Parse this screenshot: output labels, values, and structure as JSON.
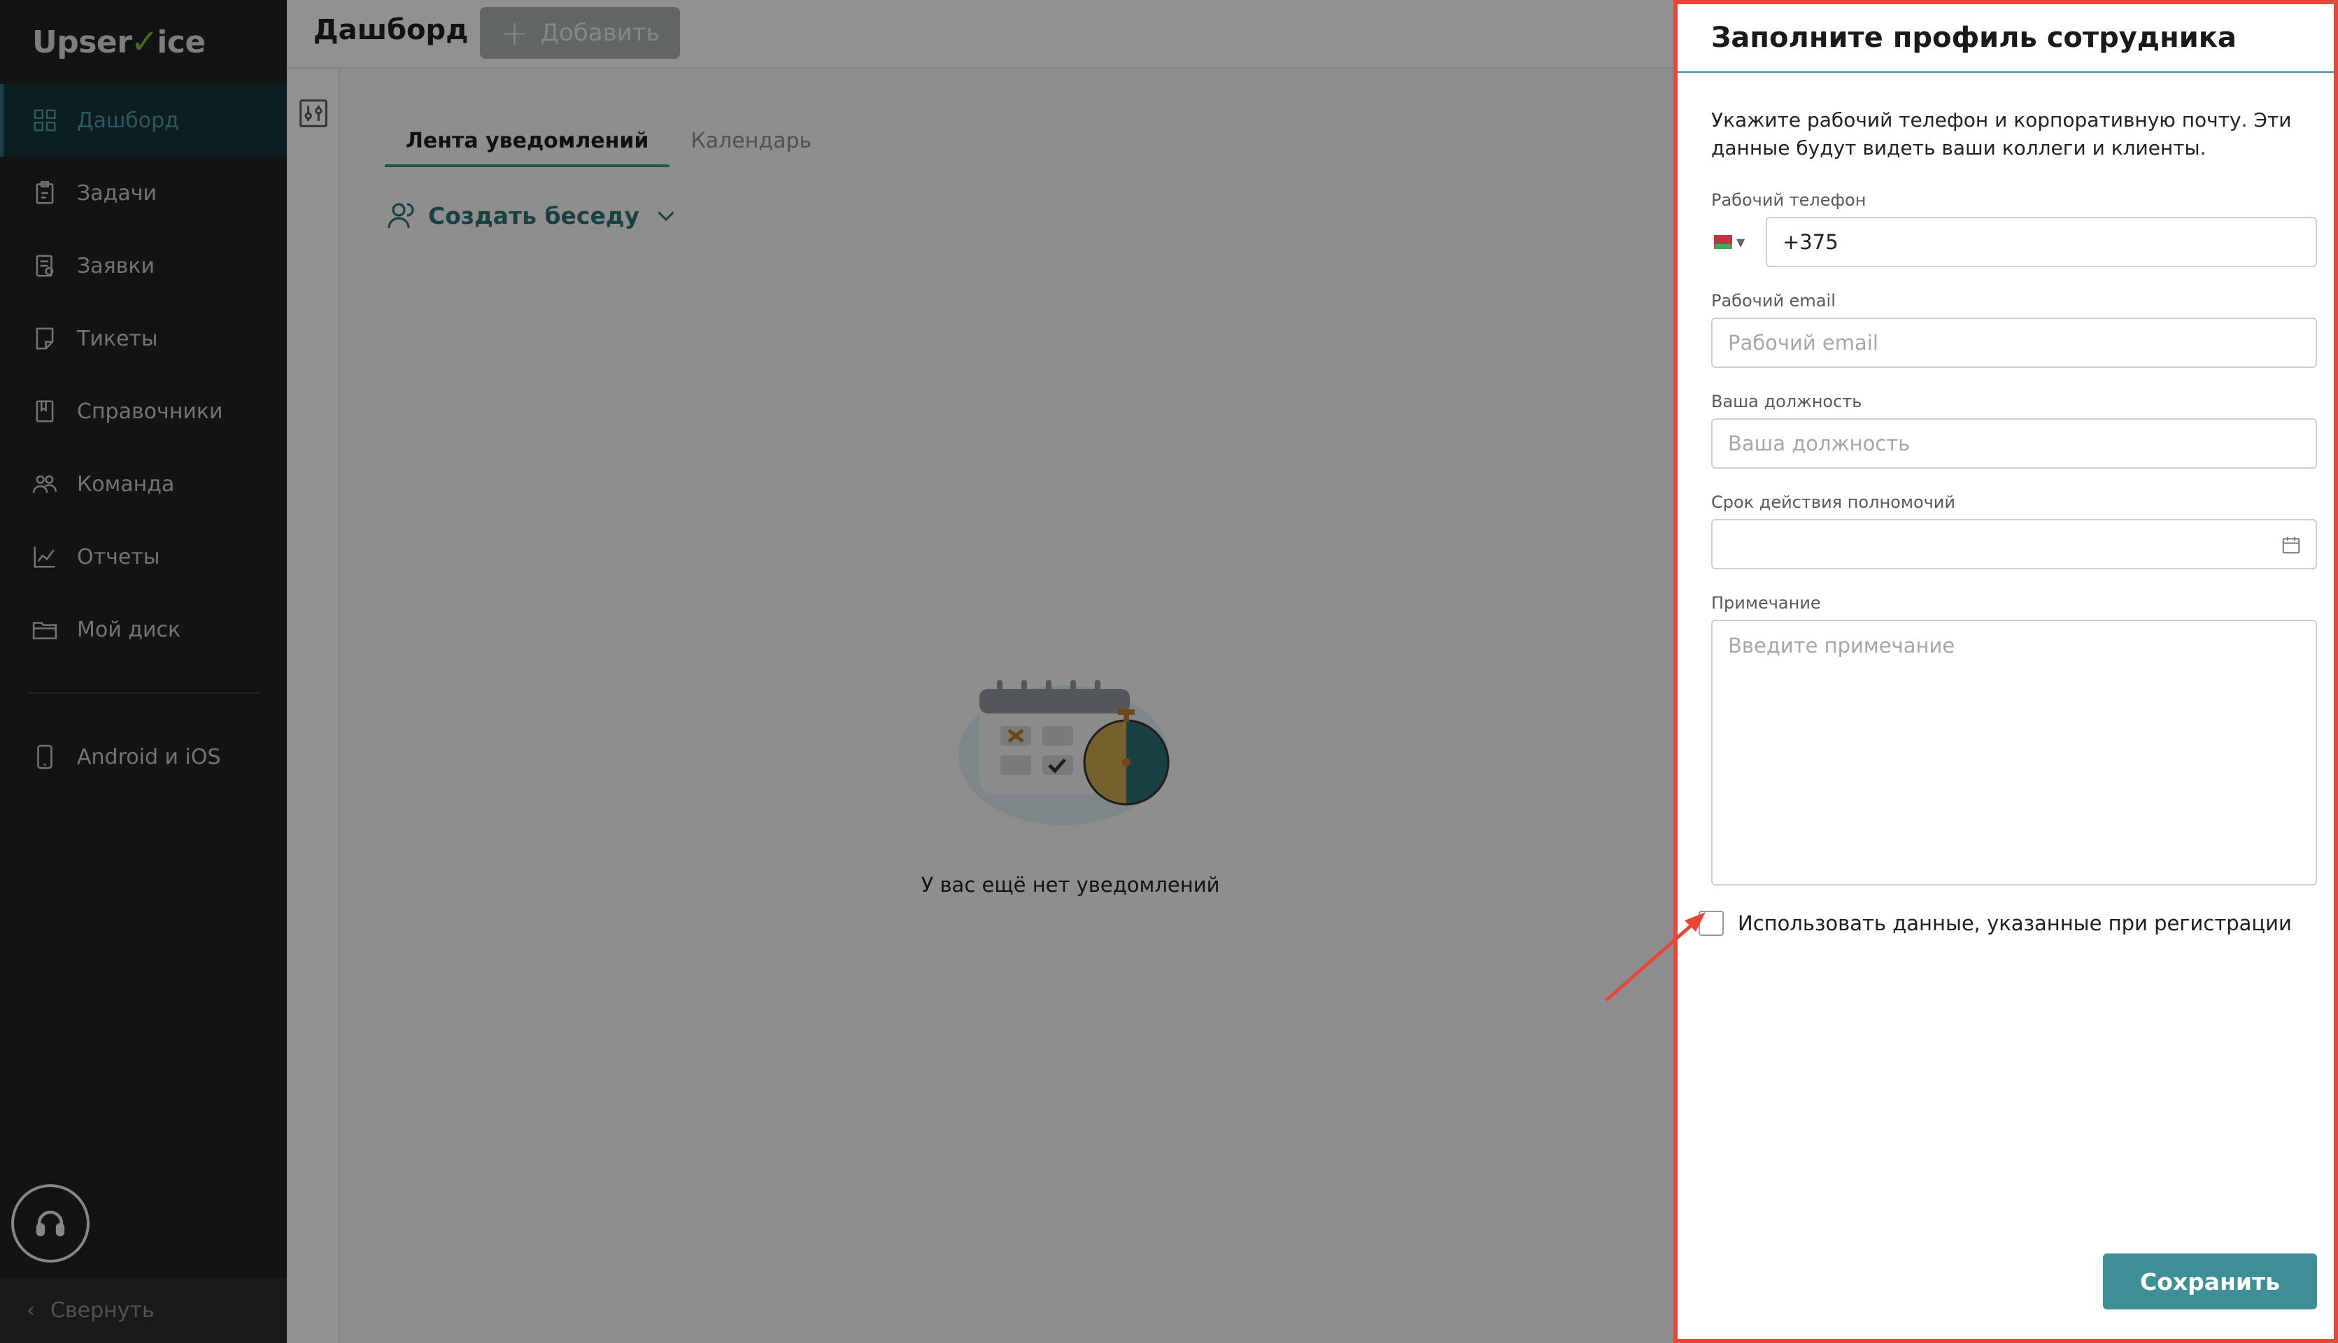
{
  "app": {
    "logo_left": "Upser",
    "logo_check": "✓",
    "logo_right": "ice"
  },
  "sidebar": {
    "items": [
      {
        "label": "Дашборд",
        "icon": "dashboard-grid-icon"
      },
      {
        "label": "Задачи",
        "icon": "task-clipboard-icon"
      },
      {
        "label": "Заявки",
        "icon": "requests-doc-icon"
      },
      {
        "label": "Тикеты",
        "icon": "ticket-note-icon"
      },
      {
        "label": "Справочники",
        "icon": "book-icon"
      },
      {
        "label": "Команда",
        "icon": "team-icon"
      },
      {
        "label": "Отчеты",
        "icon": "chart-line-icon"
      },
      {
        "label": "Мой диск",
        "icon": "folder-icon"
      }
    ],
    "mobile_label": "Android и iOS",
    "collapse_label": "Свернуть"
  },
  "header": {
    "title": "Дашборд",
    "add_label": "Добавить"
  },
  "tabs": [
    {
      "label": "Лента уведомлений"
    },
    {
      "label": "Календарь"
    }
  ],
  "create_conversation": "Создать беседу",
  "empty_state": "У вас ещё нет уведомлений",
  "drawer": {
    "title": "Заполните профиль сотрудника",
    "intro": "Укажите рабочий телефон и корпоративную почту. Эти данные будут видеть ваши коллеги и клиенты.",
    "phone_label": "Рабочий телефон",
    "phone_value": "+375",
    "email_label": "Рабочий email",
    "email_placeholder": "Рабочий email",
    "position_label": "Ваша должность",
    "position_placeholder": "Ваша должность",
    "authority_label": "Срок действия полномочий",
    "note_label": "Примечание",
    "note_placeholder": "Введите примечание",
    "use_registration_label": "Использовать данные, указанные при регистрации",
    "save_label": "Сохранить"
  },
  "colors": {
    "accent": "#3f8f97",
    "highlight": "#e5473a",
    "sidebar_bg": "#202223"
  }
}
